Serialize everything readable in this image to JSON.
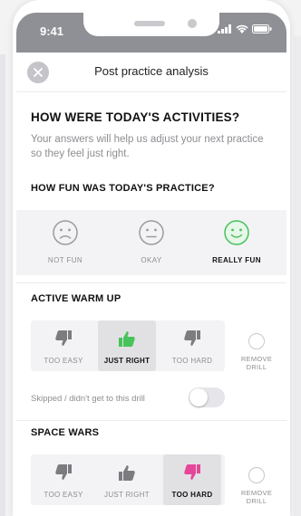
{
  "status_bar": {
    "time": "9:41"
  },
  "header": {
    "title": "Post practice analysis"
  },
  "intro": {
    "title": "HOW WERE TODAY'S ACTIVITIES?",
    "subtitle": "Your answers will help us adjust your next practice so they feel just right."
  },
  "fun": {
    "question": "HOW FUN WAS TODAY'S PRACTICE?",
    "options": [
      {
        "label": "NOT FUN",
        "face": "sad-face-icon"
      },
      {
        "label": "OKAY",
        "face": "neutral-face-icon"
      },
      {
        "label": "REALLY FUN",
        "face": "happy-face-icon"
      }
    ],
    "selected": "REALLY FUN"
  },
  "drills": [
    {
      "title": "ACTIVE WARM UP",
      "options": [
        {
          "label": "TOO EASY",
          "icon": "thumbs-down-icon"
        },
        {
          "label": "JUST RIGHT",
          "icon": "thumbs-up-icon"
        },
        {
          "label": "TOO HARD",
          "icon": "thumbs-down-icon"
        }
      ],
      "selected": "JUST RIGHT",
      "remove_label": "REMOVE DRILL",
      "skip_label": "Skipped / didn't get to this drill"
    },
    {
      "title": "SPACE WARS",
      "options": [
        {
          "label": "TOO EASY",
          "icon": "thumbs-down-icon"
        },
        {
          "label": "JUST RIGHT",
          "icon": "thumbs-up-icon"
        },
        {
          "label": "TOO HARD",
          "icon": "thumbs-down-icon"
        }
      ],
      "selected": "TOO HARD",
      "remove_label": "REMOVE DRILL"
    }
  ],
  "colors": {
    "status_bar": "#8f9096",
    "green": "#46c35a",
    "pink": "#e6469a",
    "icon_gray": "#7c7c80",
    "face_gray": "#9b9ba0"
  }
}
